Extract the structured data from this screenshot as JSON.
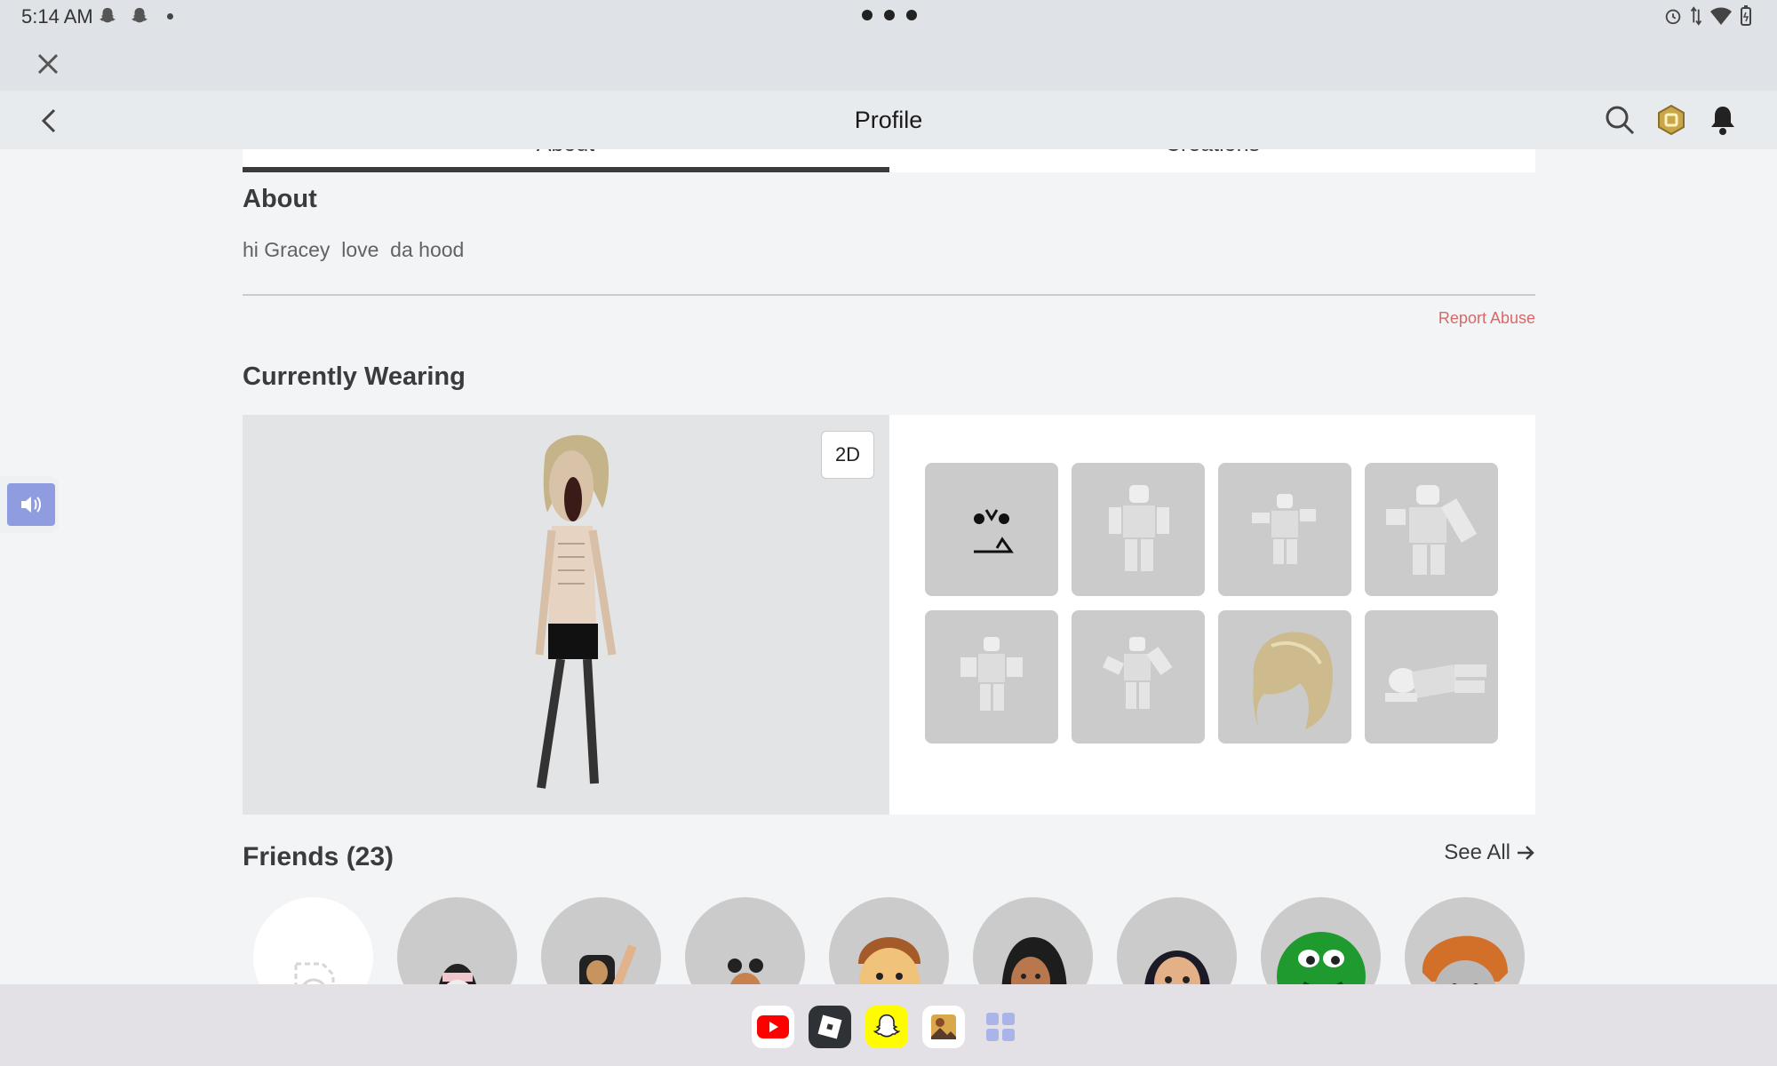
{
  "status_bar": {
    "time": "5:14 AM"
  },
  "header": {
    "title": "Profile"
  },
  "tabs": [
    {
      "label": "About"
    },
    {
      "label": "Creations"
    }
  ],
  "about": {
    "title": "About",
    "text": "hi Gracey  love  da hood",
    "report_label": "Report Abuse"
  },
  "wearing": {
    "title": "Currently Wearing",
    "toggle_label": "2D",
    "items": [
      {
        "icon": "face-icon"
      },
      {
        "icon": "animation-icon"
      },
      {
        "icon": "animation-icon"
      },
      {
        "icon": "animation-icon"
      },
      {
        "icon": "animation-icon"
      },
      {
        "icon": "animation-icon"
      },
      {
        "icon": "hair-icon"
      },
      {
        "icon": "animation-icon"
      }
    ]
  },
  "friends": {
    "title": "Friends (23)",
    "see_all": "See All"
  },
  "dock": {
    "apps": [
      {
        "icon": "youtube-icon"
      },
      {
        "icon": "roblox-icon"
      },
      {
        "icon": "snapchat-icon"
      },
      {
        "icon": "gallery-icon"
      },
      {
        "icon": "app-drawer-icon"
      }
    ]
  },
  "colors": {
    "accent_report": "#d86868",
    "tab_underline": "#393b3d",
    "item_bg": "#cbcbcb",
    "sound_btn": "#8f9de0"
  }
}
